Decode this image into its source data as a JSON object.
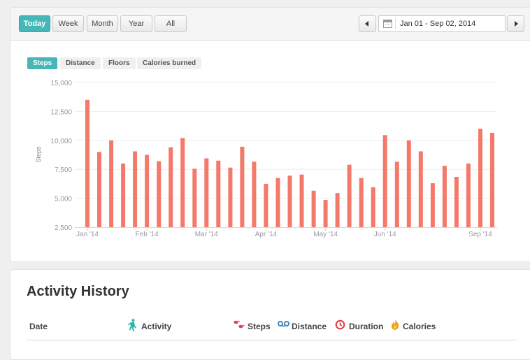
{
  "toolbar": {
    "ranges": [
      "Today",
      "Week",
      "Month",
      "Year",
      "All"
    ],
    "active_range": "Today",
    "date_range": "Jan 01 - Sep 02, 2014"
  },
  "metric_tabs": [
    "Steps",
    "Distance",
    "Floors",
    "Calories burned"
  ],
  "active_metric": "Steps",
  "chart_data": {
    "type": "bar",
    "ylabel": "Steps",
    "ylim": [
      2500,
      15000
    ],
    "yticks": [
      "15,000",
      "12,500",
      "10,000",
      "7,500",
      "5,000",
      "2,500"
    ],
    "ytick_values": [
      15000,
      12500,
      10000,
      7500,
      5000,
      2500
    ],
    "xtick_labels": [
      "Jan '14",
      "Feb '14",
      "Mar '14",
      "Apr '14",
      "May '14",
      "Jun '14",
      "Sep '14"
    ],
    "xtick_bar_index": [
      0,
      5,
      10,
      15,
      20,
      25,
      33
    ],
    "values": [
      13500,
      9000,
      10000,
      8000,
      9050,
      8750,
      8200,
      9400,
      10200,
      7550,
      8450,
      8250,
      7650,
      9450,
      8150,
      6250,
      6750,
      6950,
      7050,
      5650,
      4850,
      5450,
      7900,
      6750,
      5950,
      10450,
      8150,
      10000,
      9050,
      6300,
      7800,
      6850,
      8000,
      11000,
      10650
    ],
    "bar_color": "#f4796a",
    "grid": true
  },
  "history": {
    "title": "Activity History",
    "columns": {
      "date": "Date",
      "activity": "Activity",
      "steps": "Steps",
      "distance": "Distance",
      "duration": "Duration",
      "calories": "Calories"
    }
  },
  "colors": {
    "accent": "#47b6b6",
    "bar": "#f4796a",
    "steps_icon": "#e8405a",
    "distance_icon": "#3b86c8",
    "duration_icon": "#e03b3b",
    "calories_icon": "#f0a020"
  }
}
